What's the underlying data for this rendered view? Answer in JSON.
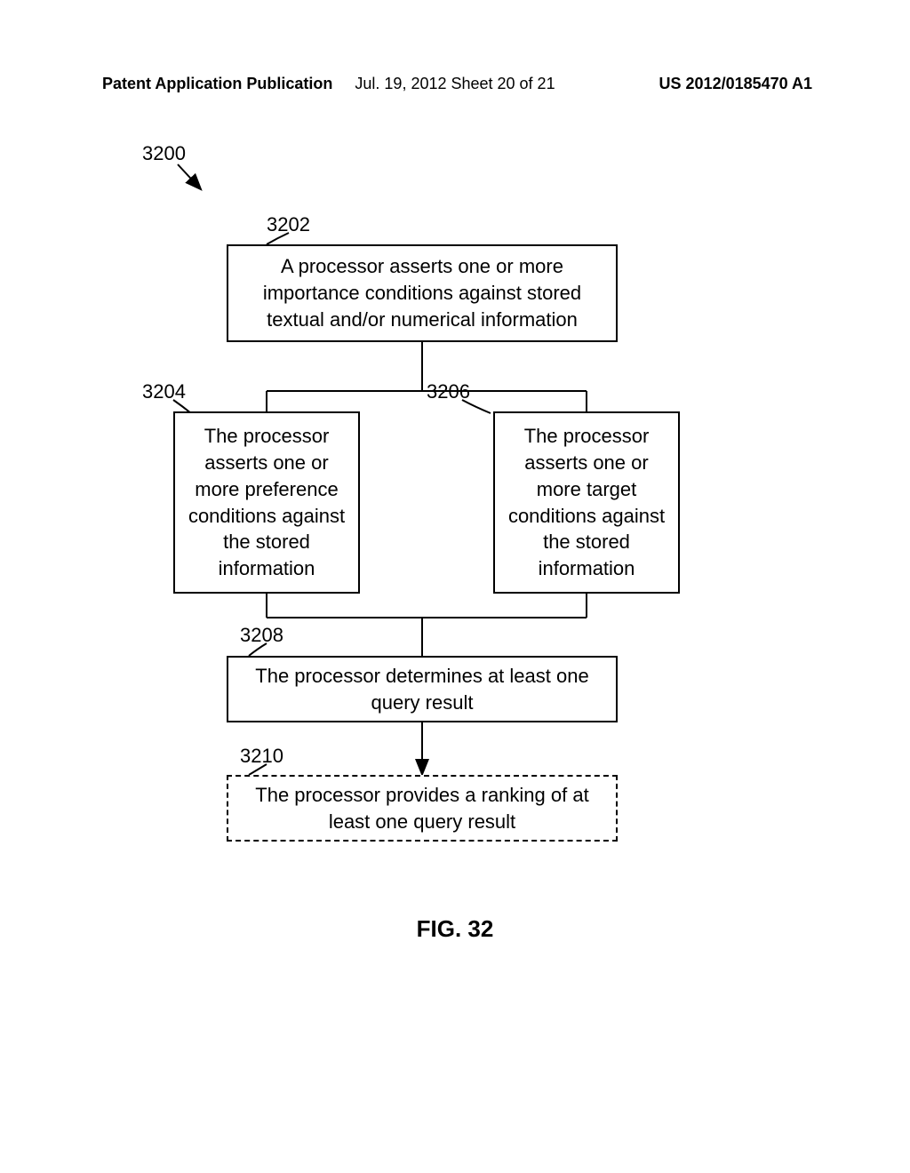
{
  "header": {
    "left": "Patent Application Publication",
    "center": "Jul. 19, 2012  Sheet 20 of 21",
    "right": "US 2012/0185470 A1"
  },
  "refs": {
    "r3200": "3200",
    "r3202": "3202",
    "r3204": "3204",
    "r3206": "3206",
    "r3208": "3208",
    "r3210": "3210"
  },
  "boxes": {
    "b3202": "A processor asserts one or more importance conditions against stored textual and/or numerical information",
    "b3204": "The processor asserts one or more preference conditions against the stored information",
    "b3206": "The processor asserts one or more target conditions against the stored information",
    "b3208": "The processor determines at least one query result",
    "b3210": "The processor provides a ranking of at least one query result"
  },
  "figure_label": "FIG. 32"
}
